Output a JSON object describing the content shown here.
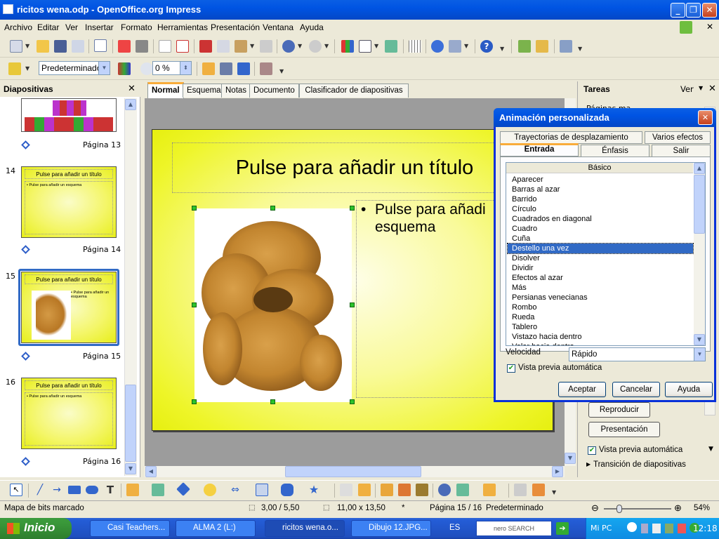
{
  "window": {
    "title": "ricitos wena.odp - OpenOffice.org Impress"
  },
  "menu": [
    "Archivo",
    "Editar",
    "Ver",
    "Insertar",
    "Formato",
    "Herramientas",
    "Presentación",
    "Ventana",
    "Ayuda"
  ],
  "toolbar2": {
    "style_value": "Predeterminado",
    "transparency_value": "0 %"
  },
  "slides_panel": {
    "header": "Diapositivas",
    "slides": [
      {
        "num": "",
        "page_label": "Página 13",
        "title": "",
        "body": ""
      },
      {
        "num": "14",
        "page_label": "Página 14",
        "title": "Pulse para añadir un título",
        "body": "• Pulse para añadir un esquema"
      },
      {
        "num": "15",
        "page_label": "Página 15",
        "title": "Pulse para añadir un título",
        "body": "• Pulse para añadir un esquema"
      },
      {
        "num": "16",
        "page_label": "Página 16",
        "title": "Pulse para añadir un título",
        "body": "• Pulse para añadir un esquema"
      }
    ]
  },
  "view_tabs": [
    "Normal",
    "Esquema",
    "Notas",
    "Documento",
    "Clasificador de diapositivas"
  ],
  "slide": {
    "title": "Pulse para añadir un título",
    "body": "Pulse para añadi esquema"
  },
  "task_pane": {
    "header": "Tareas",
    "view_label": "Ver",
    "partial_item": "Páginas ma",
    "play_button": "Reproducir",
    "presentation_button": "Presentación",
    "auto_preview_label": "Vista previa automática",
    "transition_label": "Transición de diapositivas"
  },
  "dialog": {
    "title": "Animación personalizada",
    "tabs_row1": [
      "Trayectorias de desplazamiento",
      "Varios efectos"
    ],
    "tabs_row2": [
      "Entrada",
      "Énfasis",
      "Salir"
    ],
    "category": "Básico",
    "effects": [
      "Aparecer",
      "Barras al azar",
      "Barrido",
      "Círculo",
      "Cuadrados en diagonal",
      "Cuadro",
      "Cuña",
      "Destello una vez",
      "Disolver",
      "Dividir",
      "Efectos al azar",
      "Más",
      "Persianas venecianas",
      "Rombo",
      "Rueda",
      "Tablero",
      "Vistazo hacia dentro",
      "Volar hacia dentro"
    ],
    "selected_effect": "Destello una vez",
    "speed_label": "Velocidad",
    "speed_value": "Rápido",
    "auto_preview_label": "Vista previa automática",
    "ok_button": "Aceptar",
    "cancel_button": "Cancelar",
    "help_button": "Ayuda"
  },
  "status": {
    "selection": "Mapa de bits marcado",
    "position": "3,00 / 5,50",
    "size": "11,00 x 13,50",
    "modified": "*",
    "page": "Página 15 / 16",
    "layout": "Predeterminado",
    "zoom": "54%"
  },
  "taskbar": {
    "start_label": "Inicio",
    "buttons": [
      "Casi Teachers...",
      "ALMA 2 (L:)",
      "ricitos wena.o...",
      "Dibujo 12.JPG..."
    ],
    "lang": "ES",
    "search_label": "nero SEARCH",
    "mypc": "Mi PC",
    "clock": "12:18"
  }
}
